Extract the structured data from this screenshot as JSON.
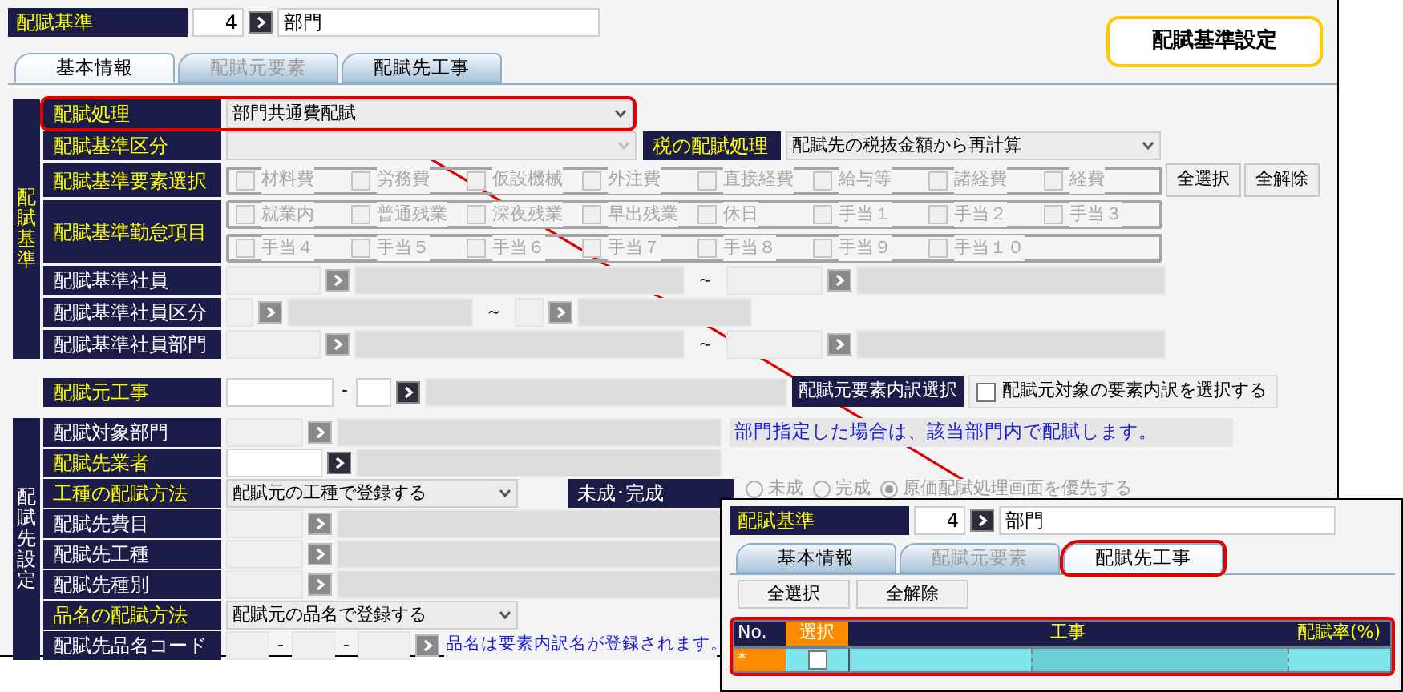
{
  "header": {
    "label": "配賦基準",
    "code": "4",
    "name": "部門"
  },
  "badge": "配賦基準設定",
  "tabs": [
    {
      "label": "基本情報",
      "selected": true,
      "disabled": false
    },
    {
      "label": "配賦元要素",
      "selected": false,
      "disabled": true
    },
    {
      "label": "配賦先工事",
      "selected": false,
      "disabled": false
    }
  ],
  "basis": {
    "title": "配賦基準",
    "required": true,
    "rows": [
      {
        "kind": "select",
        "label": "配賦処理",
        "required": true,
        "value": "部門共通費配賦",
        "disabled": false,
        "highlighted": true
      },
      {
        "kind": "select_pair",
        "label": "配賦基準区分",
        "required": true,
        "disabled": true,
        "side": {
          "label": "税の配賦処理",
          "required": true,
          "value": "配賦先の税抜金額から再計算"
        }
      },
      {
        "kind": "checks",
        "label": "配賦基準要素選択",
        "required": true,
        "disabled": true,
        "buttons": [
          "全選択",
          "全解除"
        ],
        "lines": [
          [
            {
              "label": "材料費",
              "checked": false
            },
            {
              "label": "労務費",
              "checked": false
            },
            {
              "label": "仮設機械",
              "checked": false
            },
            {
              "label": "外注費",
              "checked": false
            },
            {
              "label": "直接経費",
              "checked": false
            },
            {
              "label": "給与等",
              "checked": false
            },
            {
              "label": "諸経費",
              "checked": false
            },
            {
              "label": "経費",
              "checked": false
            }
          ]
        ]
      },
      {
        "kind": "checks",
        "label": "配賦基準勤怠項目",
        "required": true,
        "disabled": true,
        "lines": [
          [
            {
              "label": "就業内",
              "checked": false
            },
            {
              "label": "普通残業",
              "checked": false
            },
            {
              "label": "深夜残業",
              "checked": false
            },
            {
              "label": "早出残業",
              "checked": false
            },
            {
              "label": "休日",
              "checked": false
            },
            {
              "label": "手当１",
              "checked": false
            },
            {
              "label": "手当２",
              "checked": false
            },
            {
              "label": "手当３",
              "checked": false
            }
          ],
          [
            {
              "label": "手当４",
              "checked": false
            },
            {
              "label": "手当５",
              "checked": false
            },
            {
              "label": "手当６",
              "checked": false
            },
            {
              "label": "手当７",
              "checked": false
            },
            {
              "label": "手当８",
              "checked": false
            },
            {
              "label": "手当９",
              "checked": false
            },
            {
              "label": "手当１０",
              "checked": false
            }
          ]
        ]
      },
      {
        "kind": "range",
        "label": "配賦基準社員",
        "required": false,
        "separator": "～"
      },
      {
        "kind": "short_range",
        "label": "配賦基準社員区分",
        "required": false,
        "separator": "～"
      },
      {
        "kind": "range",
        "label": "配賦基準社員部門",
        "required": false,
        "separator": "～"
      }
    ]
  },
  "source": {
    "label": "配賦元工事",
    "required": true,
    "dash": "-",
    "button": "配賦元要素内訳選択",
    "option": {
      "label": "配賦元対象の要素内訳を選択する",
      "checked": false
    }
  },
  "dest": {
    "title": "配賦先設定",
    "required": false,
    "rows": [
      {
        "kind": "lookup",
        "label": "配賦対象部門",
        "required": false,
        "disabled": true,
        "note": "部門指定した場合は、該当部門内で配賦します。"
      },
      {
        "kind": "lookup",
        "label": "配賦先業者",
        "required": true,
        "disabled": false
      },
      {
        "kind": "select_radio",
        "label": "工種の配賦方法",
        "required": true,
        "value": "配賦元の工種で登録する",
        "side_label": "未成･完成",
        "radios": [
          {
            "label": "未成",
            "selected": false
          },
          {
            "label": "完成",
            "selected": false
          },
          {
            "label": "原価配賦処理画面を優先する",
            "selected": true
          }
        ]
      },
      {
        "kind": "lookup",
        "label": "配賦先費目",
        "required": false,
        "disabled": true
      },
      {
        "kind": "lookup",
        "label": "配賦先工種",
        "required": false,
        "disabled": true
      },
      {
        "kind": "lookup",
        "label": "配賦先種別",
        "required": false,
        "disabled": true
      },
      {
        "kind": "select",
        "label": "品名の配賦方法",
        "required": true,
        "value": "配賦元の品名で登録する",
        "disabled": false
      },
      {
        "kind": "code",
        "label": "配賦先品名コード",
        "required": false,
        "dash": "-",
        "note": "品名は要素内訳名が登録されます。"
      }
    ]
  },
  "inset": {
    "header": {
      "label": "配賦基準",
      "code": "4",
      "name": "部門"
    },
    "tabs": [
      {
        "label": "基本情報",
        "selected": false,
        "disabled": false,
        "highlighted": false
      },
      {
        "label": "配賦元要素",
        "selected": false,
        "disabled": true,
        "highlighted": false
      },
      {
        "label": "配賦先工事",
        "selected": true,
        "disabled": false,
        "highlighted": true
      }
    ],
    "buttons": [
      "全選択",
      "全解除"
    ],
    "grid": {
      "highlighted": true,
      "columns": [
        "No.",
        "選択",
        "工事",
        "配賦率(%)"
      ],
      "rows": [
        {
          "no": "*",
          "checked": false
        }
      ]
    }
  }
}
